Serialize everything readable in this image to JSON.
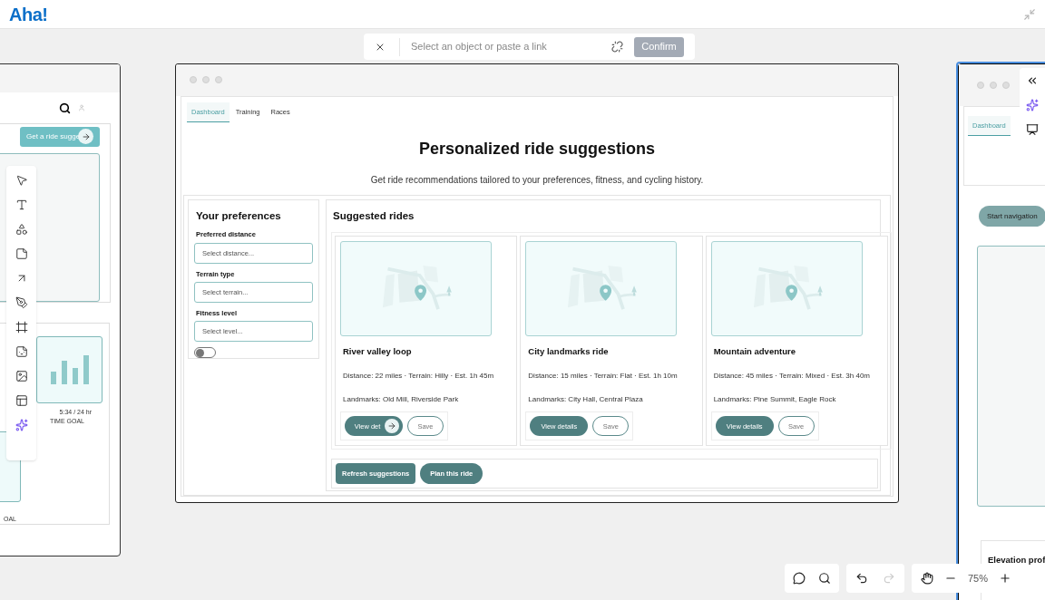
{
  "app": {
    "logo": "Aha!"
  },
  "link_bar": {
    "placeholder": "Select an object or paste a link",
    "confirm": {
      "label": "Confirm",
      "disabled": true
    }
  },
  "left_frame": {
    "button": "Get a ride sugge",
    "stat_value": "5:34 / 24 hr",
    "stat_label": "TIME GOAL",
    "cut_label": "OAL"
  },
  "main_frame": {
    "tabs": [
      {
        "label": "Dashboard",
        "selected": true
      },
      {
        "label": "Training",
        "selected": false
      },
      {
        "label": "Races",
        "selected": false
      }
    ],
    "title": "Personalized ride suggestions",
    "subtitle": "Get ride recommendations tailored to your preferences, fitness, and cycling history.",
    "preferences": {
      "title": "Your preferences",
      "fields": [
        {
          "label": "Preferred distance",
          "placeholder": "Select distance..."
        },
        {
          "label": "Terrain type",
          "placeholder": "Select terrain..."
        },
        {
          "label": "Fitness level",
          "placeholder": "Select level..."
        }
      ],
      "toggle": {
        "on": false
      }
    },
    "suggestions": {
      "title": "Suggested rides",
      "rides": [
        {
          "name": "River valley loop",
          "details": "Distance: 22 miles · Terrain: Hilly · Est. 1h 45m",
          "landmarks": "Landmarks: Old Mill, Riverside Park",
          "view_button": "View det",
          "save_button": "Save",
          "hover_arrow": true
        },
        {
          "name": "City landmarks ride",
          "details": "Distance: 15 miles · Terrain: Flat · Est. 1h 10m",
          "landmarks": "Landmarks: City Hall, Central Plaza",
          "view_button": "View details",
          "save_button": "Save",
          "hover_arrow": false
        },
        {
          "name": "Mountain adventure",
          "details": "Distance: 45 miles · Terrain: Mixed · Est. 3h 40m",
          "landmarks": "Landmarks: Pine Summit, Eagle Rock",
          "view_button": "View details",
          "save_button": "Save",
          "hover_arrow": false
        }
      ]
    },
    "actions": [
      {
        "label": "Refresh suggestions",
        "kind": "rounded"
      },
      {
        "label": "Plan this ride",
        "kind": "pill"
      }
    ]
  },
  "right_frame": {
    "tabs": [
      {
        "label": "Dashboard",
        "selected": true
      }
    ],
    "button": "Start navigation",
    "section_title": "Elevation prof"
  },
  "canvas_controls": {
    "undo": {
      "disabled": false
    },
    "redo": {
      "disabled": true
    },
    "zoom": "75%"
  }
}
